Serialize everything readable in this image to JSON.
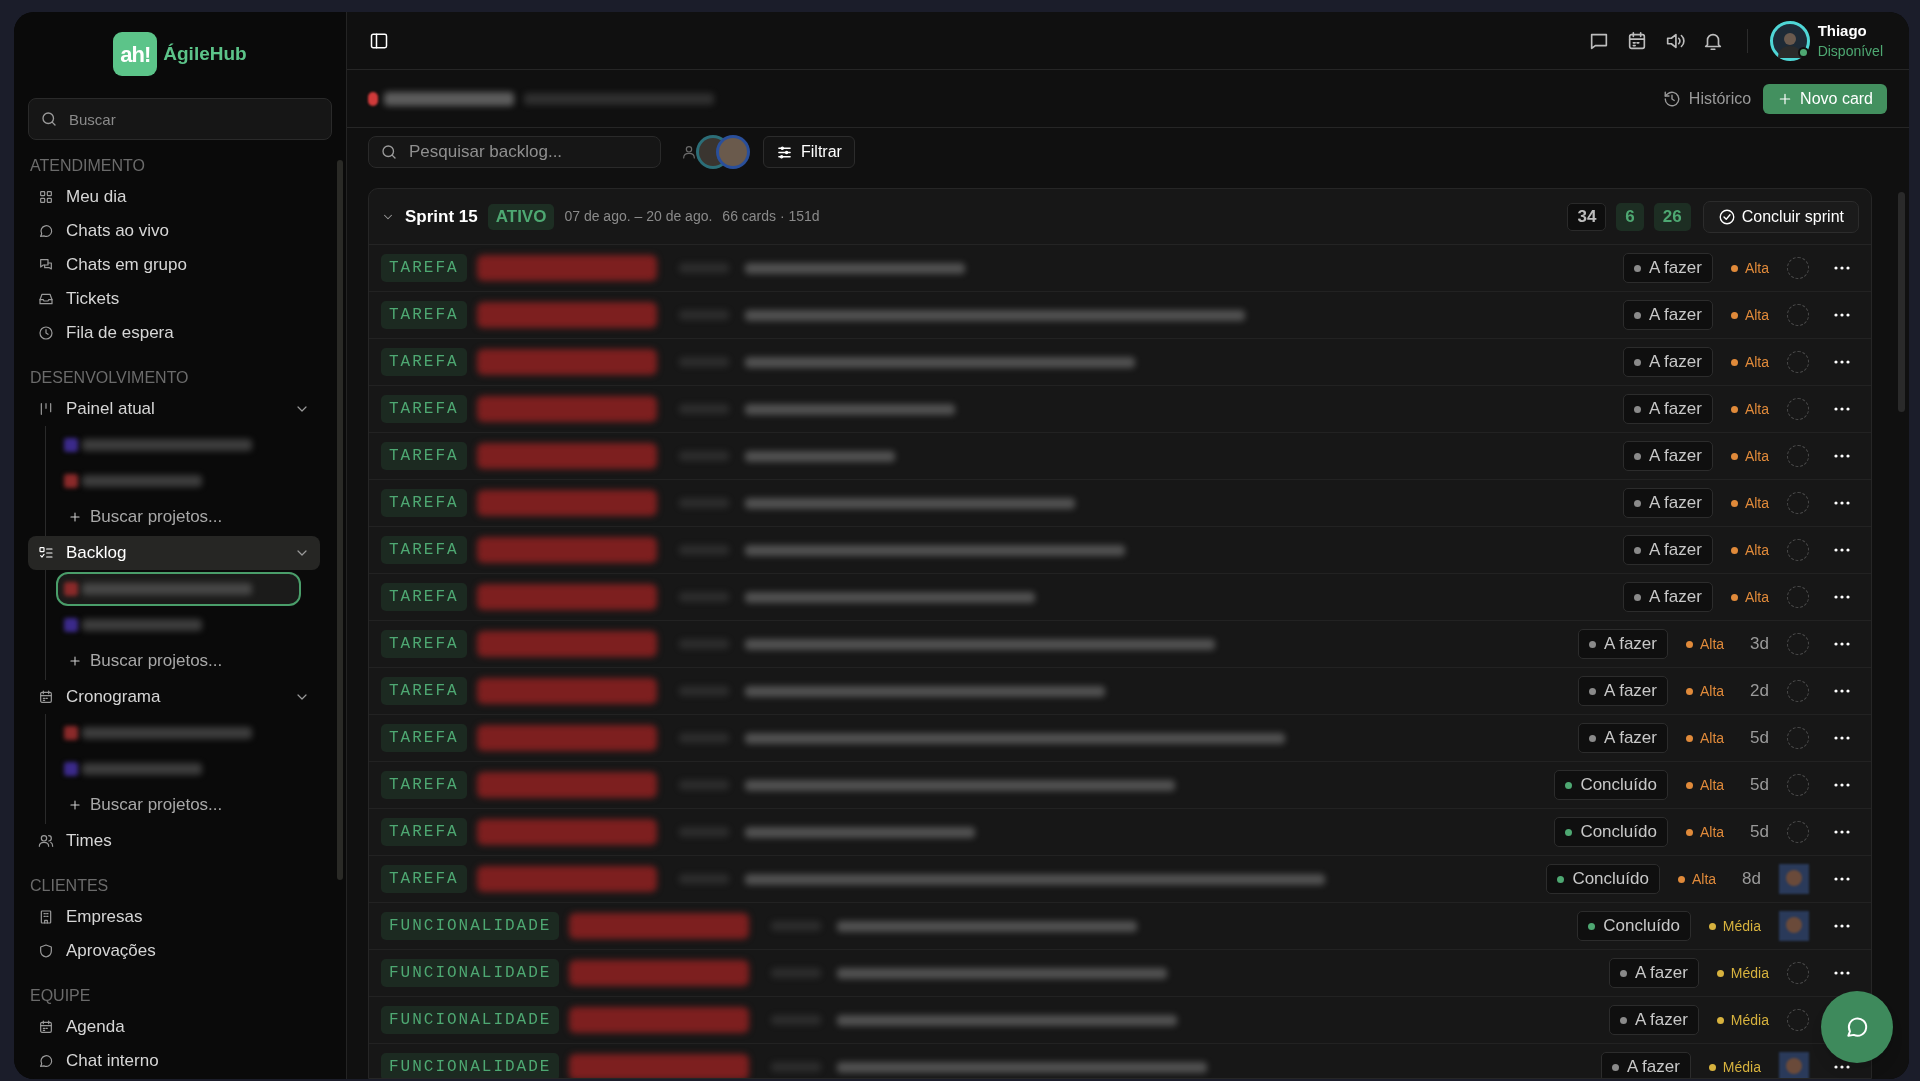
{
  "sidebar": {
    "logo": {
      "mark": "ah!",
      "name": "ÁgileHub"
    },
    "search": {
      "placeholder": "Buscar"
    },
    "sections": [
      {
        "heading": "ATENDIMENTO",
        "items": [
          {
            "label": "Meu dia",
            "selected": false
          },
          {
            "label": "Chats ao vivo",
            "selected": false
          },
          {
            "label": "Chats em grupo",
            "selected": false
          },
          {
            "label": "Tickets",
            "selected": false
          },
          {
            "label": "Fila de espera",
            "selected": false
          }
        ]
      },
      {
        "heading": "DESENVOLVIMENTO",
        "items": [
          {
            "label": "Painel atual",
            "selected": false,
            "expanded": true,
            "children": [
              {
                "kind": "project",
                "color": "#3b2a8a",
                "selected": false
              },
              {
                "kind": "project",
                "color": "#8a2a2a",
                "selected": false
              },
              {
                "kind": "add",
                "label": "Buscar projetos..."
              }
            ]
          },
          {
            "label": "Backlog",
            "selected": true,
            "expanded": true,
            "children": [
              {
                "kind": "project",
                "color": "#8a2a2a",
                "selected": true
              },
              {
                "kind": "project",
                "color": "#3b2a8a",
                "selected": false
              },
              {
                "kind": "add",
                "label": "Buscar projetos..."
              }
            ]
          },
          {
            "label": "Cronograma",
            "selected": false,
            "expanded": true,
            "children": [
              {
                "kind": "project",
                "color": "#8a2a2a",
                "selected": false
              },
              {
                "kind": "project",
                "color": "#3b2a8a",
                "selected": false
              },
              {
                "kind": "add",
                "label": "Buscar projetos..."
              }
            ]
          },
          {
            "label": "Times",
            "selected": false
          }
        ]
      },
      {
        "heading": "CLIENTES",
        "items": [
          {
            "label": "Empresas",
            "selected": false
          },
          {
            "label": "Aprovações",
            "selected": false
          }
        ]
      },
      {
        "heading": "EQUIPE",
        "items": [
          {
            "label": "Agenda",
            "selected": false
          },
          {
            "label": "Chat interno",
            "selected": false
          }
        ]
      }
    ]
  },
  "topbar": {
    "user": {
      "name": "Thiago",
      "status": "Disponível",
      "online": true
    }
  },
  "project_bar": {
    "history": "Histórico",
    "new_card": "Novo card"
  },
  "filter_bar": {
    "search": {
      "placeholder": "Pesquisar backlog..."
    },
    "filter": "Filtrar"
  },
  "sprint": {
    "name": "Sprint 15",
    "badge": "ATIVO",
    "expanded": true,
    "dates": "07 de ago. – 20 de ago.",
    "summary": "66 cards · 151d",
    "counts": [
      {
        "value": "34",
        "kind": "neutral"
      },
      {
        "value": "6",
        "kind": "green"
      },
      {
        "value": "26",
        "kind": "green"
      }
    ],
    "complete": "Concluir sprint",
    "rows": [
      {
        "type": "TAREFA",
        "status": "A fazer",
        "done": false,
        "priority": "Alta",
        "color": "#e08a3a",
        "assigned": false
      },
      {
        "type": "TAREFA",
        "status": "A fazer",
        "done": false,
        "priority": "Alta",
        "color": "#e08a3a",
        "assigned": false
      },
      {
        "type": "TAREFA",
        "status": "A fazer",
        "done": false,
        "priority": "Alta",
        "color": "#e08a3a",
        "assigned": false
      },
      {
        "type": "TAREFA",
        "status": "A fazer",
        "done": false,
        "priority": "Alta",
        "color": "#e08a3a",
        "assigned": false
      },
      {
        "type": "TAREFA",
        "status": "A fazer",
        "done": false,
        "priority": "Alta",
        "color": "#e08a3a",
        "assigned": false
      },
      {
        "type": "TAREFA",
        "status": "A fazer",
        "done": false,
        "priority": "Alta",
        "color": "#e08a3a",
        "assigned": false
      },
      {
        "type": "TAREFA",
        "status": "A fazer",
        "done": false,
        "priority": "Alta",
        "color": "#e08a3a",
        "assigned": false
      },
      {
        "type": "TAREFA",
        "status": "A fazer",
        "done": false,
        "priority": "Alta",
        "color": "#e08a3a",
        "assigned": false
      },
      {
        "type": "TAREFA",
        "status": "A fazer",
        "done": false,
        "priority": "Alta",
        "color": "#e08a3a",
        "due": "3d",
        "assigned": false
      },
      {
        "type": "TAREFA",
        "status": "A fazer",
        "done": false,
        "priority": "Alta",
        "color": "#e08a3a",
        "due": "2d",
        "assigned": false
      },
      {
        "type": "TAREFA",
        "status": "A fazer",
        "done": false,
        "priority": "Alta",
        "color": "#e08a3a",
        "due": "5d",
        "assigned": false
      },
      {
        "type": "TAREFA",
        "status": "Concluído",
        "done": true,
        "priority": "Alta",
        "color": "#e08a3a",
        "due": "5d",
        "assigned": false
      },
      {
        "type": "TAREFA",
        "status": "Concluído",
        "done": true,
        "priority": "Alta",
        "color": "#e08a3a",
        "due": "5d",
        "assigned": false
      },
      {
        "type": "TAREFA",
        "status": "Concluído",
        "done": true,
        "priority": "Alta",
        "color": "#e08a3a",
        "due": "8d",
        "assigned": true
      },
      {
        "type": "FUNCIONALIDADE",
        "status": "Concluído",
        "done": true,
        "priority": "Média",
        "color": "#d7b23e",
        "assigned": true
      },
      {
        "type": "FUNCIONALIDADE",
        "status": "A fazer",
        "done": false,
        "priority": "Média",
        "color": "#d7b23e",
        "assigned": false
      },
      {
        "type": "FUNCIONALIDADE",
        "status": "A fazer",
        "done": false,
        "priority": "Média",
        "color": "#d7b23e",
        "assigned": false
      },
      {
        "type": "FUNCIONALIDADE",
        "status": "A fazer",
        "done": false,
        "priority": "Média",
        "color": "#d7b23e",
        "assigned": true
      }
    ]
  }
}
